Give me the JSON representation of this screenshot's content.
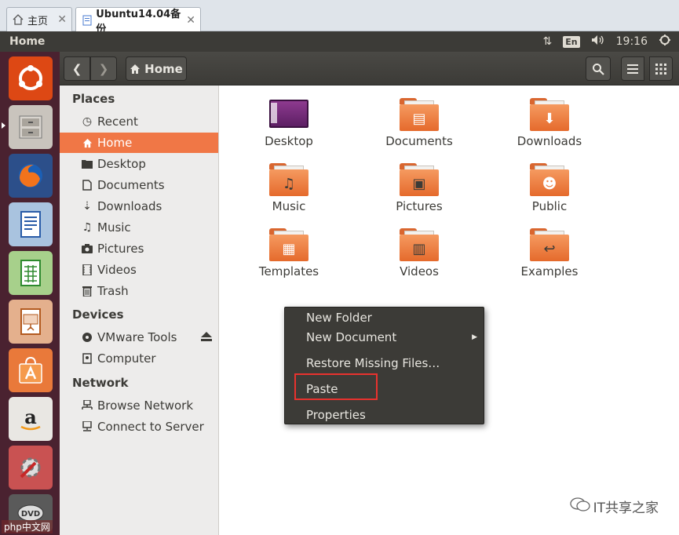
{
  "browser_tabs": [
    {
      "label": "主页",
      "icon": "home-icon"
    },
    {
      "label": "Ubuntu14.04备份",
      "icon": "page-icon"
    }
  ],
  "topbar": {
    "title": "Home",
    "time": "19:16",
    "language": "En"
  },
  "toolbar": {
    "home_label": "Home"
  },
  "sidebar": {
    "places_header": "Places",
    "places": [
      {
        "label": "Recent",
        "icon": "clock-icon"
      },
      {
        "label": "Home",
        "icon": "home-icon"
      },
      {
        "label": "Desktop",
        "icon": "folder-icon"
      },
      {
        "label": "Documents",
        "icon": "document-icon"
      },
      {
        "label": "Downloads",
        "icon": "download-icon"
      },
      {
        "label": "Music",
        "icon": "music-icon"
      },
      {
        "label": "Pictures",
        "icon": "camera-icon"
      },
      {
        "label": "Videos",
        "icon": "film-icon"
      },
      {
        "label": "Trash",
        "icon": "trash-icon"
      }
    ],
    "devices_header": "Devices",
    "devices": [
      {
        "label": "VMware Tools",
        "icon": "disc-icon"
      },
      {
        "label": "Computer",
        "icon": "harddisk-icon"
      }
    ],
    "network_header": "Network",
    "network": [
      {
        "label": "Browse Network",
        "icon": "network-icon"
      },
      {
        "label": "Connect to Server",
        "icon": "server-icon"
      }
    ]
  },
  "files": [
    {
      "name": "Desktop",
      "icon": "desktop-folder-icon"
    },
    {
      "name": "Documents",
      "icon": "documents-folder-icon"
    },
    {
      "name": "Downloads",
      "icon": "downloads-folder-icon"
    },
    {
      "name": "Music",
      "icon": "music-folder-icon"
    },
    {
      "name": "Pictures",
      "icon": "pictures-folder-icon"
    },
    {
      "name": "Public",
      "icon": "public-folder-icon"
    },
    {
      "name": "Templates",
      "icon": "templates-folder-icon"
    },
    {
      "name": "Videos",
      "icon": "videos-folder-icon"
    },
    {
      "name": "Examples",
      "icon": "examples-folder-icon"
    }
  ],
  "context_menu": {
    "items": [
      {
        "label": "New Folder",
        "has_submenu": false
      },
      {
        "label": "New Document",
        "has_submenu": true
      },
      {
        "label": "Restore Missing Files…",
        "has_submenu": false
      },
      {
        "label": "Paste",
        "has_submenu": false
      },
      {
        "label": "Properties",
        "has_submenu": false
      }
    ]
  },
  "watermark": {
    "text": "IT共享之家",
    "corner_text": "php中文网"
  },
  "colors": {
    "accent": "#f07746",
    "panel": "#3c3b37",
    "launcher": "#4a2230",
    "highlight": "#e8322e"
  }
}
